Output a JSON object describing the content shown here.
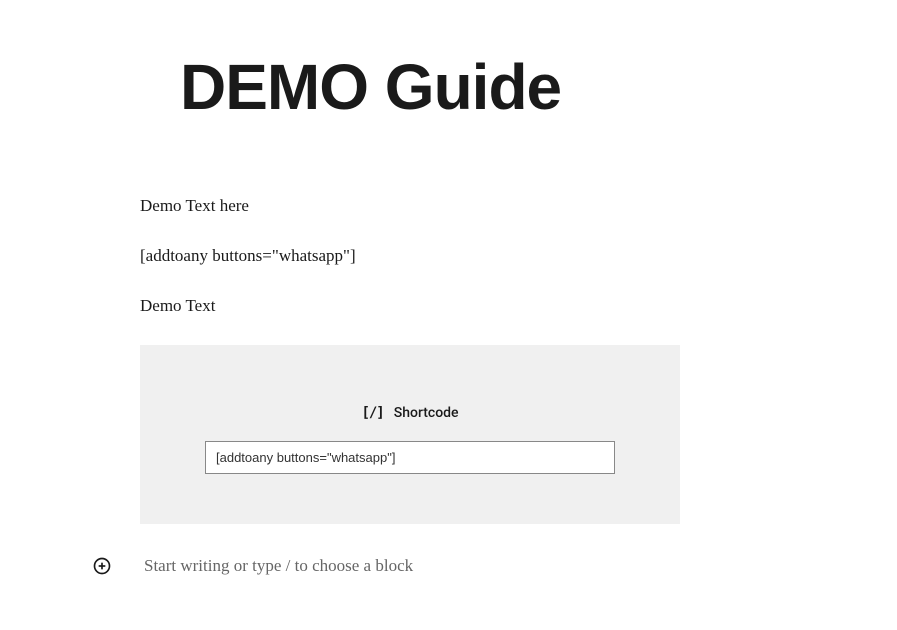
{
  "title": "DEMO Guide",
  "paragraphs": {
    "p1": "Demo Text here",
    "p2": " [addtoany buttons=\"whatsapp\"]",
    "p3": "Demo Text"
  },
  "shortcode_block": {
    "label": "Shortcode",
    "icon_text": "[/]",
    "input_value": "[addtoany buttons=\"whatsapp\"]"
  },
  "new_block": {
    "placeholder": "Start writing or type / to choose a block"
  }
}
